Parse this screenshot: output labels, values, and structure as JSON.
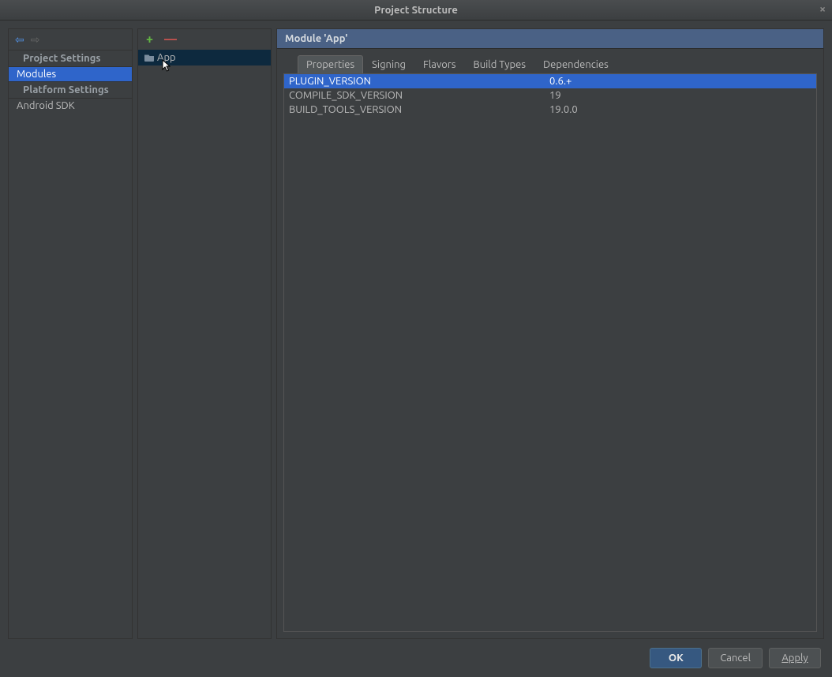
{
  "window": {
    "title": "Project Structure"
  },
  "sidebar": {
    "sections": {
      "project": {
        "header": "Project Settings",
        "items": [
          "Modules"
        ]
      },
      "platform": {
        "header": "Platform Settings",
        "items": [
          "Android SDK"
        ]
      }
    },
    "selected": "Modules"
  },
  "modules": {
    "items": [
      "App"
    ],
    "selected": "App"
  },
  "detail": {
    "header": "Module 'App'",
    "tabs": [
      "Properties",
      "Signing",
      "Flavors",
      "Build Types",
      "Dependencies"
    ],
    "active_tab": "Properties",
    "properties": [
      {
        "key": "PLUGIN_VERSION",
        "value": "0.6.+"
      },
      {
        "key": "COMPILE_SDK_VERSION",
        "value": "19"
      },
      {
        "key": "BUILD_TOOLS_VERSION",
        "value": "19.0.0"
      }
    ],
    "selected_property_index": 0
  },
  "buttons": {
    "ok": "OK",
    "cancel": "Cancel",
    "apply": "Apply"
  }
}
